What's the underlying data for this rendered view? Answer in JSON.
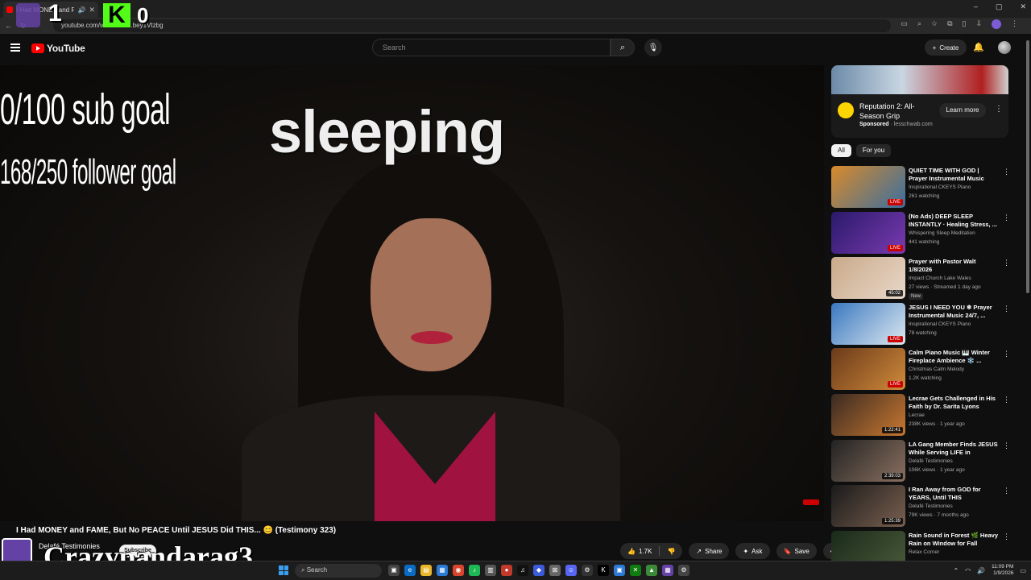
{
  "browser": {
    "tab_title": "I Had MONEY and FAME, B...",
    "url": "youtube.com/watch?v=...bey1Vtzbg"
  },
  "overlay": {
    "twitch_count": "1",
    "kick_logo": "K",
    "kick_count": "0",
    "sub_goal": "0/100 sub goal",
    "follower_goal": "168/250 follower goal",
    "status": "sleeping",
    "streamer_name": "Crazypandarag3"
  },
  "header": {
    "logo_text": "YouTube",
    "search_placeholder": "Search",
    "create_label": "Create"
  },
  "video": {
    "title": "I Had MONEY and FAME, But No PEACE Until JESUS Did THIS... 😊 (Testimony 323)",
    "channel": "Delafé Testimonies",
    "subscribe_label": "Subscribe",
    "likes": "1.7K",
    "share_label": "Share",
    "ask_label": "Ask",
    "save_label": "Save"
  },
  "ad": {
    "title": "Reputation 2: All-Season Grip",
    "sponsored": "Sponsored",
    "domain": "lesschwab.com",
    "cta": "Learn more"
  },
  "chips": [
    "All",
    "For you"
  ],
  "recommendations": [
    {
      "title": "QUIET TIME WITH GOD | Prayer Instrumental Music 24/7, ...",
      "channel": "Inspirational CKEYS Piano",
      "meta": "261 watching",
      "badge": "LIVE",
      "live": true,
      "colors": [
        "#d98a2a",
        "#3a6fa0"
      ]
    },
    {
      "title": "(No Ads) DEEP SLEEP INSTANTLY · Healing Stress, ...",
      "channel": "Whispering Sleep Meditation",
      "meta": "441 watching",
      "badge": "LIVE",
      "live": true,
      "colors": [
        "#2a1a6a",
        "#7a3ab0"
      ]
    },
    {
      "title": "Prayer with Pastor Walt 1/8/2026",
      "channel": "Impact Church Lake Wales",
      "meta": "27 views · Streamed 1 day ago",
      "badge": "45:02",
      "live": false,
      "is_new": "New",
      "colors": [
        "#c9a98a",
        "#e8d8c8"
      ]
    },
    {
      "title": "JESUS I NEED YOU ❄ Prayer Instrumental Music 24/7, ...",
      "channel": "Inspirational CKEYS Piano",
      "meta": "78 watching",
      "badge": "LIVE",
      "live": true,
      "colors": [
        "#3a78c0",
        "#dde8f0"
      ]
    },
    {
      "title": "Calm Piano Music 🎹 Winter Fireplace Ambience ❄️ ...",
      "channel": "Christmas Calm Melody",
      "meta": "1.2K watching",
      "badge": "LIVE",
      "live": true,
      "colors": [
        "#6a3a1a",
        "#d08a3a"
      ]
    },
    {
      "title": "Lecrae Gets Challenged in His Faith by Dr. Sarita Lyons",
      "channel": "Lecrae",
      "meta": "238K views · 1 year ago",
      "badge": "1:22:41",
      "live": false,
      "colors": [
        "#3a2a22",
        "#c87830"
      ]
    },
    {
      "title": "LA Gang Member Finds JESUS While Serving LIFE in PRISON....",
      "channel": "Delafé Testimonies",
      "meta": "106K views · 1 year ago",
      "badge": "2:39:03",
      "live": false,
      "colors": [
        "#222222",
        "#8a7060"
      ]
    },
    {
      "title": "I Ran Away from GOD for YEARS, Until THIS Happened....",
      "channel": "Delafé Testimonies",
      "meta": "79K views · 7 months ago",
      "badge": "1:25:39",
      "live": false,
      "colors": [
        "#1a1a1a",
        "#7a6050"
      ]
    },
    {
      "title": "Rain Sound in Forest 🌿 Heavy Rain on Window for Fall Aslee...",
      "channel": "Relax Corner",
      "meta": "",
      "badge": "",
      "live": false,
      "colors": [
        "#1a2a1a",
        "#4a5a3a"
      ]
    }
  ],
  "taskbar": {
    "search_label": "Search",
    "time": "11:09 PM",
    "date": "1/9/2026"
  },
  "colors": {
    "background": "#0f0f0f",
    "accent_red": "#ff0000",
    "twitch_purple": "#6441a5",
    "kick_green": "#53fc18"
  }
}
